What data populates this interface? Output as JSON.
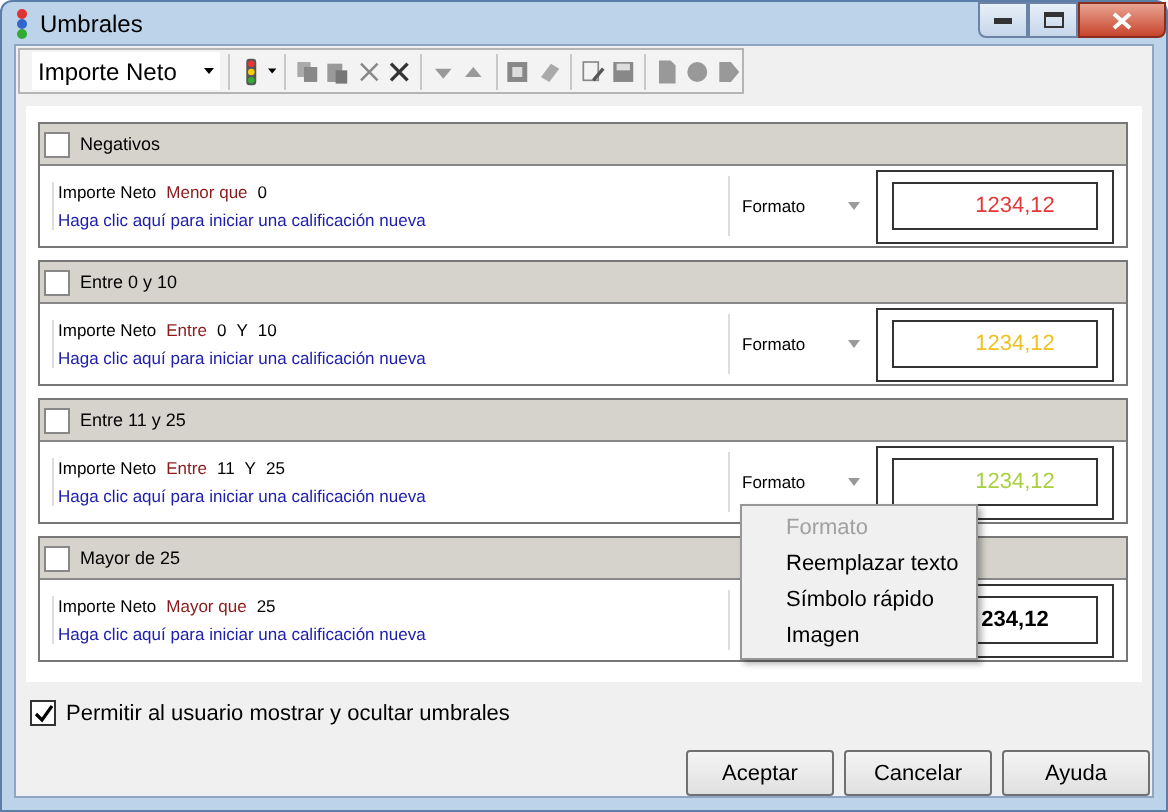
{
  "window": {
    "title": "Umbrales"
  },
  "toolbar": {
    "field_select": "Importe Neto"
  },
  "thresholds": [
    {
      "name": "Negativos",
      "checked": false,
      "condition": [
        {
          "kind": "field",
          "text": "Importe Neto"
        },
        {
          "kind": "operator",
          "text": "Menor que"
        },
        {
          "kind": "value",
          "text": "0"
        }
      ],
      "prompt": "Haga clic aquí para iniciar una calificación nueva",
      "format": "Formato",
      "sample": "1234,12",
      "color": "#e03a3a",
      "bold": false
    },
    {
      "name": "Entre 0 y 10",
      "checked": false,
      "condition": [
        {
          "kind": "field",
          "text": "Importe Neto"
        },
        {
          "kind": "operator",
          "text": "Entre"
        },
        {
          "kind": "value",
          "text": "0"
        },
        {
          "kind": "value",
          "text": "Y"
        },
        {
          "kind": "value",
          "text": "10"
        }
      ],
      "prompt": "Haga clic aquí para iniciar una calificación nueva",
      "format": "Formato",
      "sample": "1234,12",
      "color": "#f0c020",
      "bold": false
    },
    {
      "name": "Entre 11 y 25",
      "checked": false,
      "condition": [
        {
          "kind": "field",
          "text": "Importe Neto"
        },
        {
          "kind": "operator",
          "text": "Entre"
        },
        {
          "kind": "value",
          "text": "11"
        },
        {
          "kind": "value",
          "text": "Y"
        },
        {
          "kind": "value",
          "text": "25"
        }
      ],
      "prompt": "Haga clic aquí para iniciar una calificación nueva",
      "format": "Formato",
      "sample": "1234,12",
      "color": "#a8d040",
      "bold": false
    },
    {
      "name": "Mayor de 25",
      "checked": false,
      "condition": [
        {
          "kind": "field",
          "text": "Importe Neto"
        },
        {
          "kind": "operator",
          "text": "Mayor que"
        },
        {
          "kind": "value",
          "text": "25"
        }
      ],
      "prompt": "Haga clic aquí para iniciar una calificación nueva",
      "sample": "234,12",
      "color": "#000000",
      "bold": true
    }
  ],
  "context_menu": [
    {
      "label": "Formato",
      "disabled": true
    },
    {
      "label": "Reemplazar texto",
      "disabled": false
    },
    {
      "label": "Símbolo rápido",
      "disabled": false
    },
    {
      "label": "Imagen",
      "disabled": false
    }
  ],
  "allow_toggle": {
    "label": "Permitir al usuario mostrar y ocultar umbrales",
    "checked": true
  },
  "buttons": [
    "Aceptar",
    "Cancelar",
    "Ayuda"
  ]
}
